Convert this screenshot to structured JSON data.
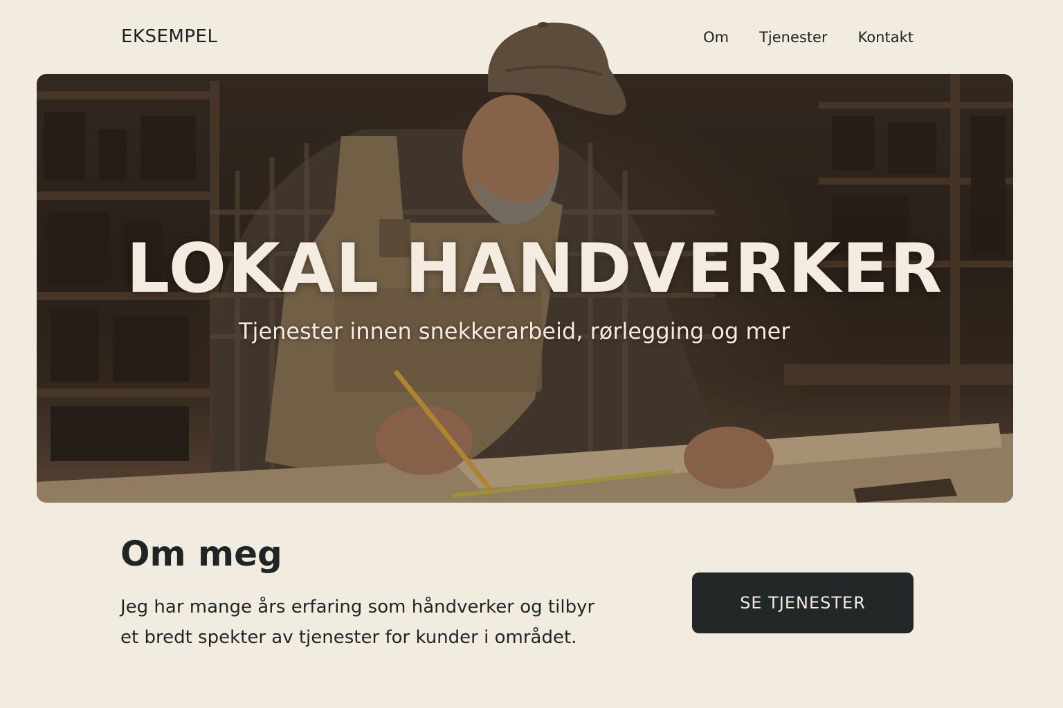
{
  "header": {
    "brand": "EKSEMPEL",
    "nav": [
      "Om",
      "Tjenester",
      "Kontakt"
    ]
  },
  "hero": {
    "title": "LOKAL HANDVERKER",
    "subtitle": "Tjenester innen snekkerarbeid, rørlegging og mer",
    "image": "carpenter-measuring-wood-photo"
  },
  "about": {
    "title": "Om meg",
    "text": "Jeg har mange års erfaring som håndverker og tilbyr et bredt spekter av tjenester for kunder i området."
  },
  "cta": {
    "label": "SE TJENESTER"
  },
  "colors": {
    "background": "#f2ebe0",
    "text": "#1f2525",
    "button": "#222828",
    "button_text": "#f4ece1"
  }
}
